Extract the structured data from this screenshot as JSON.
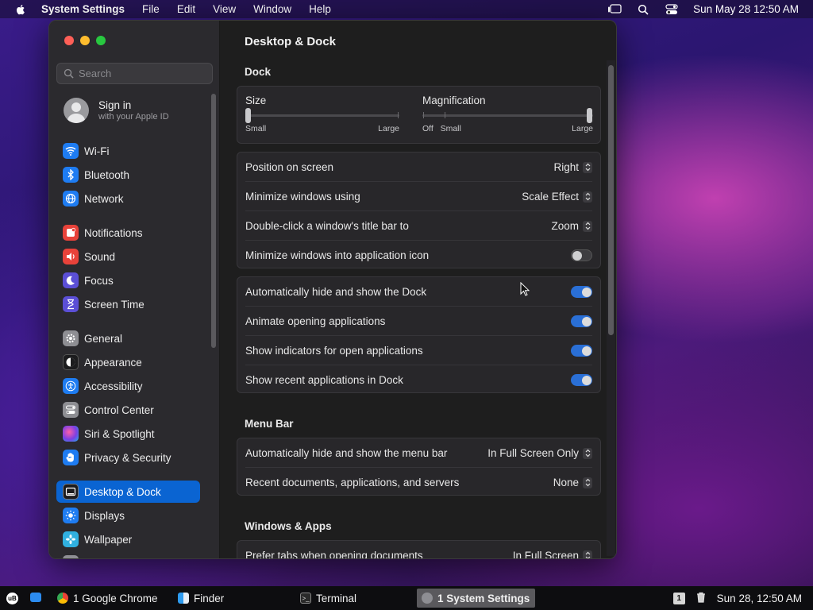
{
  "menubar": {
    "app_name": "System Settings",
    "items": [
      "File",
      "Edit",
      "View",
      "Window",
      "Help"
    ],
    "clock": "Sun May 28  12:50 AM"
  },
  "window": {
    "search_placeholder": "Search",
    "signin": {
      "title": "Sign in",
      "subtitle": "with your Apple ID"
    },
    "sidebar": [
      {
        "label": "Wi-Fi",
        "icon": "wifi-icon",
        "color": "#1e7cf2"
      },
      {
        "label": "Bluetooth",
        "icon": "bluetooth-icon",
        "color": "#1e7cf2"
      },
      {
        "label": "Network",
        "icon": "globe-icon",
        "color": "#1e7cf2"
      },
      {
        "label": "Notifications",
        "icon": "bell-icon",
        "color": "#e8423a"
      },
      {
        "label": "Sound",
        "icon": "speaker-icon",
        "color": "#e8423a"
      },
      {
        "label": "Focus",
        "icon": "moon-icon",
        "color": "#5b4fd6"
      },
      {
        "label": "Screen Time",
        "icon": "hourglass-icon",
        "color": "#5b4fd6"
      },
      {
        "label": "General",
        "icon": "gear-icon",
        "color": "#8e8e93"
      },
      {
        "label": "Appearance",
        "icon": "appearance-icon",
        "color": "#1c1c1e"
      },
      {
        "label": "Accessibility",
        "icon": "accessibility-icon",
        "color": "#1e7cf2"
      },
      {
        "label": "Control Center",
        "icon": "control-center-icon",
        "color": "#8e8e93"
      },
      {
        "label": "Siri & Spotlight",
        "icon": "siri-icon",
        "color": "#8a3fd1"
      },
      {
        "label": "Privacy & Security",
        "icon": "hand-icon",
        "color": "#1e7cf2"
      },
      {
        "label": "Desktop & Dock",
        "icon": "dock-icon",
        "color": "#1c1c1e"
      },
      {
        "label": "Displays",
        "icon": "sun-icon",
        "color": "#1e7cf2"
      },
      {
        "label": "Wallpaper",
        "icon": "flower-icon",
        "color": "#30b0e0"
      }
    ],
    "active_item": "Desktop & Dock"
  },
  "main": {
    "title": "Desktop & Dock",
    "dock_section": "Dock",
    "size": {
      "label": "Size",
      "min": "Small",
      "max": "Large",
      "value": 0.0
    },
    "magnification": {
      "label": "Magnification",
      "off": "Off",
      "min": "Small",
      "max": "Large",
      "value": 1.0
    },
    "dock_rows": [
      {
        "label": "Position on screen",
        "value": "Right"
      },
      {
        "label": "Minimize windows using",
        "value": "Scale Effect"
      },
      {
        "label": "Double-click a window's title bar to",
        "value": "Zoom"
      },
      {
        "label": "Minimize windows into application icon",
        "toggle": false
      }
    ],
    "dock_toggles": [
      {
        "label": "Automatically hide and show the Dock",
        "toggle": true
      },
      {
        "label": "Animate opening applications",
        "toggle": true
      },
      {
        "label": "Show indicators for open applications",
        "toggle": true
      },
      {
        "label": "Show recent applications in Dock",
        "toggle": true
      }
    ],
    "menubar_section": "Menu Bar",
    "menubar_rows": [
      {
        "label": "Automatically hide and show the menu bar",
        "value": "In Full Screen Only"
      },
      {
        "label": "Recent documents, applications, and servers",
        "value": "None"
      }
    ],
    "windows_section": "Windows & Apps",
    "windows_rows": [
      {
        "label": "Prefer tabs when opening documents",
        "value": "In Full Screen"
      }
    ]
  },
  "taskbar": {
    "apps": [
      {
        "label": "1 Google Chrome",
        "icon": "chrome-icon"
      },
      {
        "label": "Finder",
        "icon": "finder-icon"
      },
      {
        "label": "Terminal",
        "icon": "terminal-icon"
      },
      {
        "label": "1 System Settings",
        "icon": "settings-icon",
        "active": true
      }
    ],
    "workspace": "1",
    "clock": "Sun 28, 12:50 AM"
  }
}
